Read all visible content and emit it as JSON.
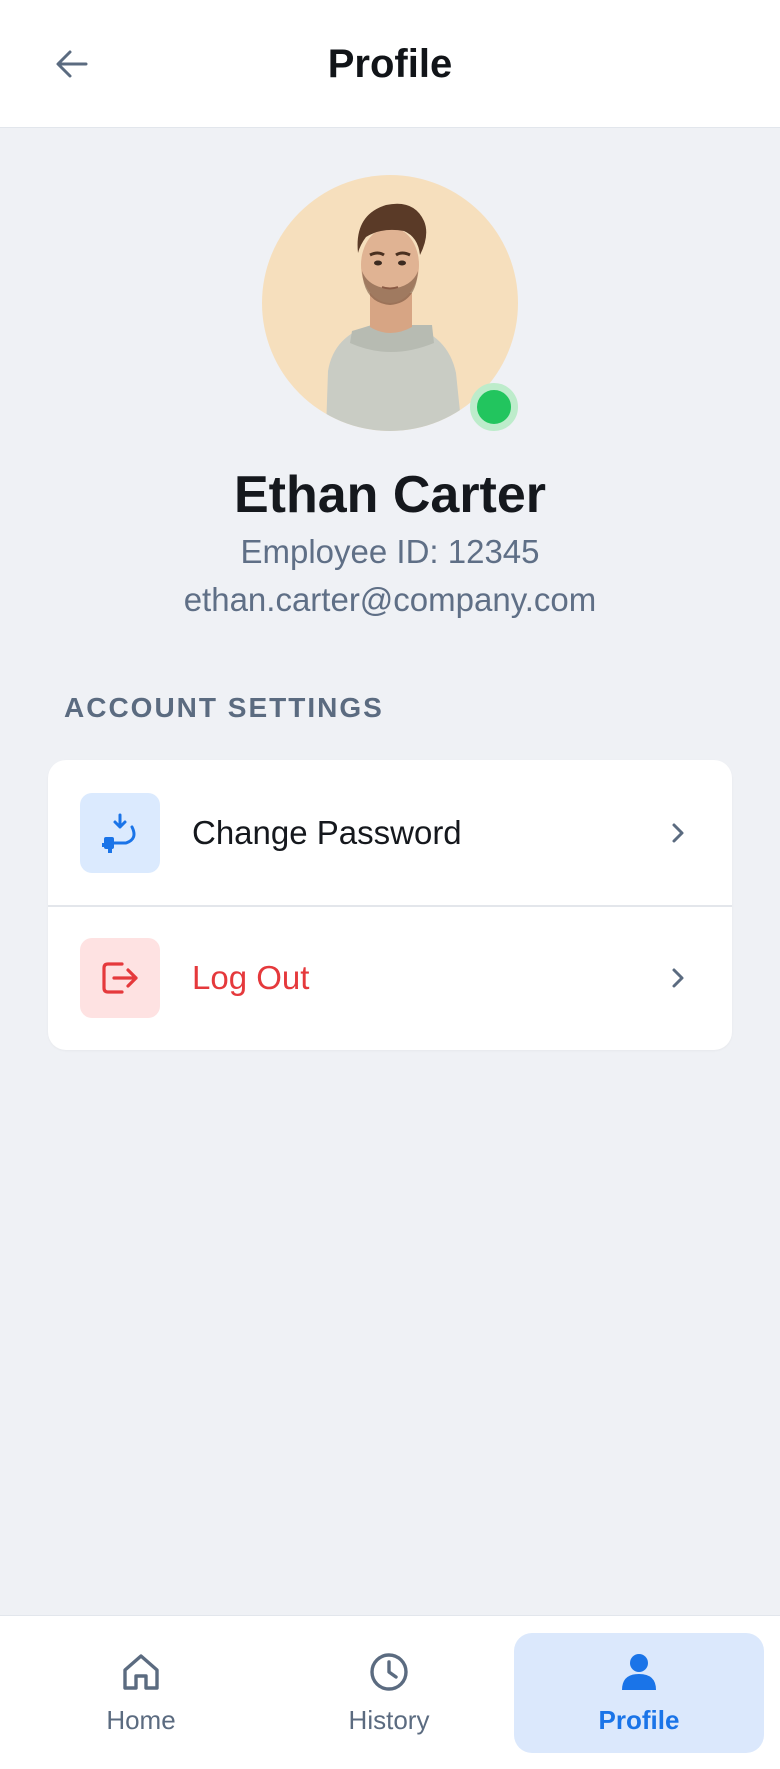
{
  "header": {
    "title": "Profile",
    "back_icon": "arrow-left-icon"
  },
  "profile": {
    "name": "Ethan Carter",
    "employee_id": "Employee ID: 12345",
    "email": "ethan.carter@company.com",
    "status": "online",
    "status_color": "#22c55e"
  },
  "account_settings": {
    "title": "ACCOUNT SETTINGS",
    "items": [
      {
        "label": "Change Password",
        "icon": "key-icon",
        "accent": "#1a74e8",
        "chevron": "chevron-right-icon"
      },
      {
        "label": "Log Out",
        "icon": "logout-icon",
        "accent": "#e5393c",
        "chevron": "chevron-right-icon"
      }
    ]
  },
  "bottom_nav": {
    "items": [
      {
        "label": "Home",
        "icon": "home-icon",
        "active": false
      },
      {
        "label": "History",
        "icon": "clock-icon",
        "active": false
      },
      {
        "label": "Profile",
        "icon": "person-icon",
        "active": true
      }
    ],
    "active_color": "#1a74e8",
    "inactive_color": "#5b6b80"
  }
}
